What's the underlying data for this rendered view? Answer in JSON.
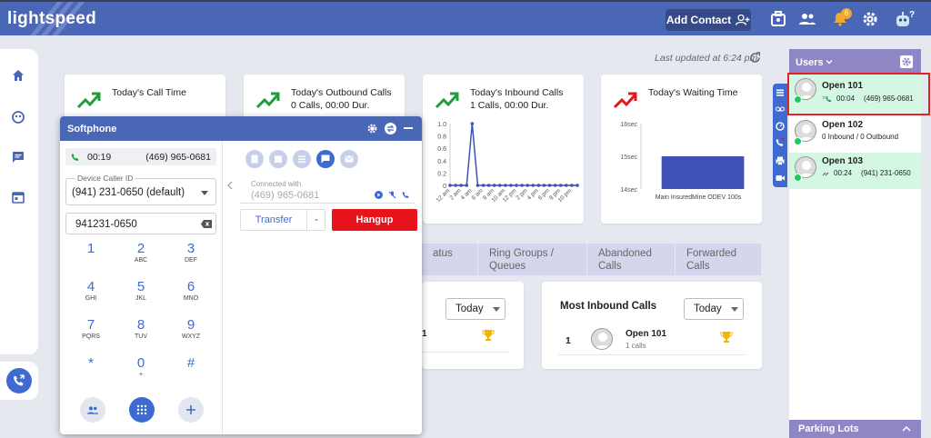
{
  "app": {
    "logo": "lightspeed"
  },
  "header": {
    "add_contact_label": "Add Contact",
    "notification_count": "6"
  },
  "last_updated": "Last updated at 6:24 pm",
  "cards": {
    "call_time": {
      "title": "Today's Call Time"
    },
    "outbound": {
      "title": "Today's Outbound Calls",
      "sub": "0 Calls, 00:00 Dur."
    },
    "inbound": {
      "title": "Today's Inbound Calls",
      "sub": "1 Calls, 00:00 Dur."
    },
    "waiting": {
      "title": "Today's Waiting Time"
    }
  },
  "chart_data": [
    {
      "type": "line",
      "title": "Today's Inbound Calls",
      "x": [
        "12 am",
        "1 am",
        "2 am",
        "3 am",
        "4 am",
        "5 am",
        "6 am",
        "7 am",
        "8 am",
        "9 am",
        "10 am",
        "11 am",
        "12 pm",
        "1 pm",
        "2 pm",
        "3 pm",
        "4 pm",
        "5 pm",
        "6 pm",
        "7 pm",
        "8 pm",
        "9 pm",
        "10 pm",
        "11 pm"
      ],
      "tick_labels": [
        "12 am",
        "2 am",
        "4 am",
        "6 am",
        "8 am",
        "10 am",
        "12 pm",
        "2 pm",
        "4 pm",
        "6 pm",
        "8 pm",
        "10 pm"
      ],
      "values": [
        0,
        0,
        0,
        0,
        1,
        0,
        0,
        0,
        0,
        0,
        0,
        0,
        0,
        0,
        0,
        0,
        0,
        0,
        0,
        0,
        0,
        0,
        0,
        0
      ],
      "ylim": [
        0,
        1.0
      ],
      "yticks": [
        "1.0",
        "0.8",
        "0.6",
        "0.4",
        "0.2",
        "0"
      ],
      "color": "#3f51b5"
    },
    {
      "type": "bar",
      "title": "Today's Waiting Time",
      "categories": [
        "Main InsuredMine ODEV 100s"
      ],
      "values": [
        15
      ],
      "ylim": [
        14,
        16
      ],
      "yticks": [
        "16sec",
        "15sec",
        "14sec"
      ],
      "color": "#3f51b5"
    }
  ],
  "softphone": {
    "title": "Softphone",
    "active_call": {
      "duration": "00:19",
      "number": "(469) 965-0681"
    },
    "caller_id": {
      "label": "Device Caller ID",
      "value": "(941) 231-0650 (default)"
    },
    "dial_input": "941231-0650",
    "keys": [
      {
        "d": "1",
        "l": ""
      },
      {
        "d": "2",
        "l": "ABC"
      },
      {
        "d": "3",
        "l": "DEF"
      },
      {
        "d": "4",
        "l": "GHI"
      },
      {
        "d": "5",
        "l": "JKL"
      },
      {
        "d": "6",
        "l": "MNO"
      },
      {
        "d": "7",
        "l": "PQRS"
      },
      {
        "d": "8",
        "l": "TUV"
      },
      {
        "d": "9",
        "l": "WXYZ"
      },
      {
        "d": "*",
        "l": ""
      },
      {
        "d": "0",
        "l": "+"
      },
      {
        "d": "#",
        "l": ""
      }
    ],
    "connected_label": "Connected with",
    "connected_number": "(469) 965-0681",
    "transfer_label": "Transfer",
    "hangup_label": "Hangup"
  },
  "tabs": [
    {
      "label": "atus"
    },
    {
      "label": "Ring Groups / Queues"
    },
    {
      "label": "Abandoned Calls"
    },
    {
      "label": "Forwarded Calls"
    }
  ],
  "panel_left": {
    "dropdown": "Today",
    "row_suffix": "1"
  },
  "most_inbound": {
    "title": "Most Inbound Calls",
    "dropdown": "Today",
    "rank": "1",
    "name": "Open 101",
    "calls": "1 calls"
  },
  "users": {
    "title": "Users",
    "list": [
      {
        "name": "Open 101",
        "duration": "00:04",
        "number": "(469) 965-0681",
        "status": "active"
      },
      {
        "name": "Open 102",
        "summary": "0 Inbound / 0 Outbound",
        "status": "idle"
      },
      {
        "name": "Open 103",
        "duration": "00:24",
        "number": "(941) 231-0650",
        "status": "active"
      }
    ]
  },
  "parking": {
    "title": "Parking Lots"
  },
  "colors": {
    "primary": "#4a67b6",
    "accent": "#3f6ad1",
    "hangup": "#e8141b",
    "highlight": "#d4f7e3",
    "panel_head": "#8f86c5"
  }
}
